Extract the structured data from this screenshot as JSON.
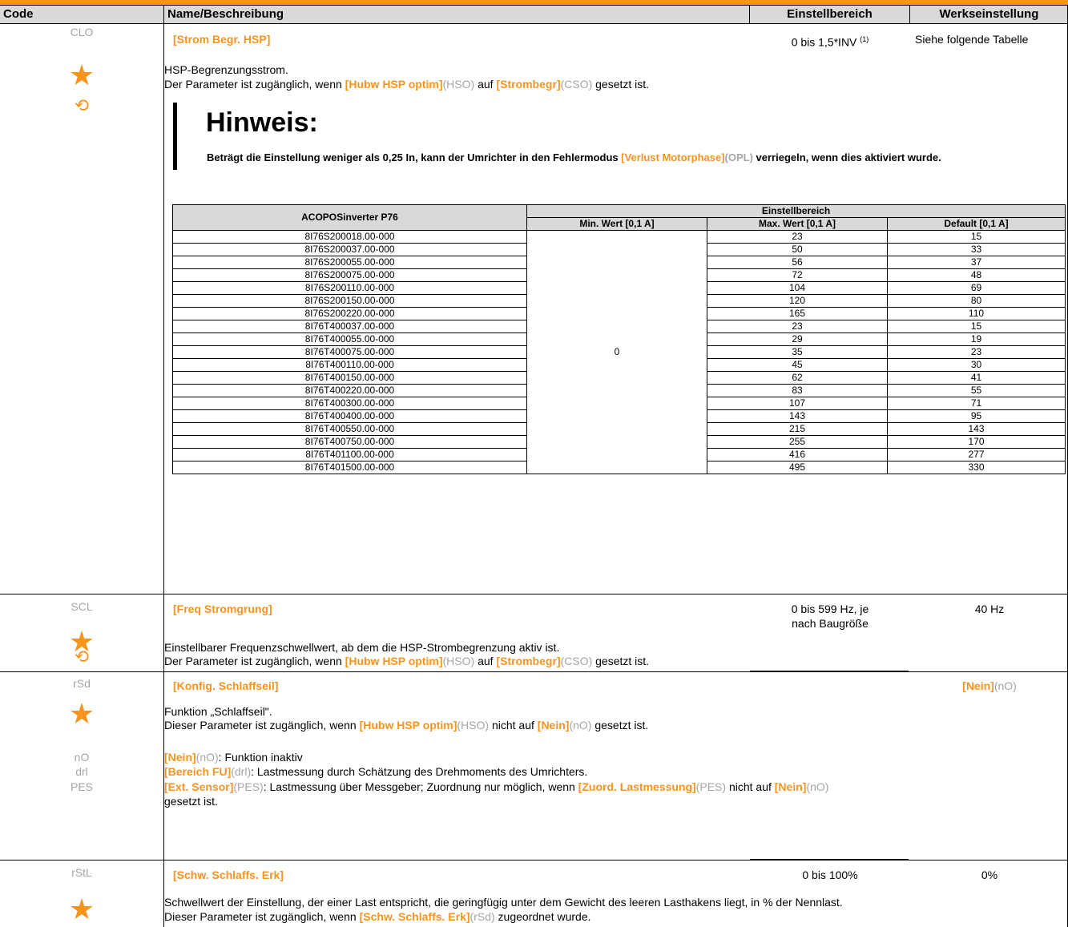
{
  "header": {
    "code": "Code",
    "name": "Name/Beschreibung",
    "range": "Einstellbereich",
    "factory": "Werkseinstellung",
    "accent_color": "#f7941d"
  },
  "params": {
    "clo": {
      "code": "CLO",
      "name": "[Strom Begr. HSP]",
      "range": "0 bis 1,5*INV",
      "range_sup": "(1)",
      "factory": "Siehe folgende Tabelle",
      "desc1": "HSP-Begrenzungsstrom.",
      "desc2_a": "Der Parameter ist zugänglich, wenn ",
      "desc2_b": "[Hubw HSP optim]",
      "desc2_c": "(HSO)",
      "desc2_d": " auf ",
      "desc2_e": "[Strombegr]",
      "desc2_f": "(CSO)",
      "desc2_g": " gesetzt ist.",
      "note_title": "Hinweis:",
      "note_a": "Beträgt die Einstellung weniger als 0,25 In, kann der Umrichter in den Fehlermodus ",
      "note_b": "[Verlust Motorphase]",
      "note_c": "(OPL)",
      "note_d": " verriegeln, wenn dies aktiviert wurde.",
      "icons": [
        "star-icon",
        "rotate-icon"
      ]
    },
    "scl": {
      "code": "SCL",
      "name": "[Freq Stromgrung]",
      "range_1": "0 bis 599 Hz, je",
      "range_2": "nach Baugröße",
      "factory": "40 Hz",
      "desc1": "Einstellbarer Frequenzschwellwert, ab dem die HSP-Strombegrenzung aktiv ist.",
      "desc2_a": "Der Parameter ist zugänglich, wenn ",
      "desc2_b": "[Hubw HSP optim]",
      "desc2_c": "(HSO)",
      "desc2_d": " auf ",
      "desc2_e": "[Strombegr]",
      "desc2_f": "(CSO)",
      "desc2_g": " gesetzt ist."
    },
    "rsd": {
      "code": "rSd",
      "name": "[Konfig. Schlaffseil]",
      "factory_a": "[Nein]",
      "factory_b": "(nO)",
      "desc1": "Funktion „Schlaffseil\".",
      "desc2_a": "Dieser Parameter ist zugänglich, wenn ",
      "desc2_b": "[Hubw HSP optim]",
      "desc2_c": "(HSO)",
      "desc2_d": " nicht auf ",
      "desc2_e": "[Nein]",
      "desc2_f": "(nO)",
      "desc2_g": " gesetzt ist.",
      "opt_no_code": "nO",
      "opt_no_a": "[Nein]",
      "opt_no_b": "(nO)",
      "opt_no_c": ": Funktion inaktiv",
      "opt_drl_code": "drl",
      "opt_drl_a": "[Bereich FU]",
      "opt_drl_b": "(drl)",
      "opt_drl_c": ": Lastmessung durch Schätzung des Drehmoments des Umrichters.",
      "opt_pes_code": "PES",
      "opt_pes_a": "[Ext. Sensor]",
      "opt_pes_b": "(PES)",
      "opt_pes_c": ": Lastmessung über Messgeber; Zuordnung nur möglich, wenn ",
      "opt_pes_d": "[Zuord. Lastmessung]",
      "opt_pes_e": "(PES)",
      "opt_pes_f": " nicht auf ",
      "opt_pes_g": "[Nein]",
      "opt_pes_h": "(nO)",
      "opt_pes_i": "gesetzt ist."
    },
    "rstl": {
      "code": "rStL",
      "name": "[Schw. Schlaffs. Erk]",
      "range": "0 bis 100%",
      "factory": "0%",
      "desc1": "Schwellwert der Einstellung, der einer Last entspricht, die geringfügig unter dem Gewicht des leeren Lasthakens liegt, in % der Nennlast.",
      "desc2_a": "Dieser Parameter ist zugänglich, wenn ",
      "desc2_b": "[Schw. Schlaffs. Erk]",
      "desc2_c": "(rSd)",
      "desc2_d": " zugeordnet wurde."
    }
  },
  "table": {
    "col_model": "ACOPOSinverter P76",
    "col_group": "Einstellbereich",
    "col_min": "Min. Wert [0,1 A]",
    "col_max": "Max. Wert [0,1 A]",
    "col_default": "Default [0,1 A]",
    "min_value": "0",
    "rows": [
      {
        "model": "8I76S200018.00-000",
        "max": "23",
        "def": "15"
      },
      {
        "model": "8I76S200037.00-000",
        "max": "50",
        "def": "33"
      },
      {
        "model": "8I76S200055.00-000",
        "max": "56",
        "def": "37"
      },
      {
        "model": "8I76S200075.00-000",
        "max": "72",
        "def": "48"
      },
      {
        "model": "8I76S200110.00-000",
        "max": "104",
        "def": "69"
      },
      {
        "model": "8I76S200150.00-000",
        "max": "120",
        "def": "80"
      },
      {
        "model": "8I76S200220.00-000",
        "max": "165",
        "def": "110"
      },
      {
        "model": "8I76T400037.00-000",
        "max": "23",
        "def": "15"
      },
      {
        "model": "8I76T400055.00-000",
        "max": "29",
        "def": "19"
      },
      {
        "model": "8I76T400075.00-000",
        "max": "35",
        "def": "23"
      },
      {
        "model": "8I76T400110.00-000",
        "max": "45",
        "def": "30"
      },
      {
        "model": "8I76T400150.00-000",
        "max": "62",
        "def": "41"
      },
      {
        "model": "8I76T400220.00-000",
        "max": "83",
        "def": "55"
      },
      {
        "model": "8I76T400300.00-000",
        "max": "107",
        "def": "71"
      },
      {
        "model": "8I76T400400.00-000",
        "max": "143",
        "def": "95"
      },
      {
        "model": "8I76T400550.00-000",
        "max": "215",
        "def": "143"
      },
      {
        "model": "8I76T400750.00-000",
        "max": "255",
        "def": "170"
      },
      {
        "model": "8I76T401100.00-000",
        "max": "416",
        "def": "277"
      },
      {
        "model": "8I76T401500.00-000",
        "max": "495",
        "def": "330"
      }
    ]
  }
}
